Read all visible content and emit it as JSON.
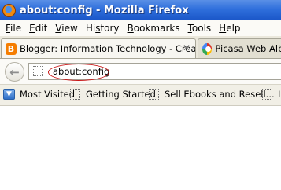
{
  "window": {
    "title": "about:config - Mozilla Firefox",
    "icon": "firefox-icon"
  },
  "menu": [
    {
      "pre": "",
      "u": "F",
      "post": "ile"
    },
    {
      "pre": "",
      "u": "E",
      "post": "dit"
    },
    {
      "pre": "",
      "u": "V",
      "post": "iew"
    },
    {
      "pre": "Hi",
      "u": "s",
      "post": "tory"
    },
    {
      "pre": "",
      "u": "B",
      "post": "ookmarks"
    },
    {
      "pre": "",
      "u": "T",
      "post": "ools"
    },
    {
      "pre": "",
      "u": "H",
      "post": "elp"
    }
  ],
  "tabs": [
    {
      "label": "Blogger: Information Technology - Creat...",
      "icon": "blogger-icon",
      "close": "✕"
    },
    {
      "label": "Picasa Web Album",
      "icon": "picasa-icon"
    }
  ],
  "nav": {
    "back_glyph": "←",
    "url": "about:config",
    "site_icon": "page-icon"
  },
  "bookmarks": [
    {
      "label": "Most Visited",
      "icon": "most-visited-icon"
    },
    {
      "label": "Getting Started",
      "icon": "page-icon"
    },
    {
      "label": "Sell Ebooks and Resell...",
      "icon": "page-icon"
    },
    {
      "label": "I",
      "icon": "page-icon"
    }
  ],
  "colors": {
    "title_bar": "#2f6fdc",
    "annotation_ellipse": "#c81414"
  }
}
